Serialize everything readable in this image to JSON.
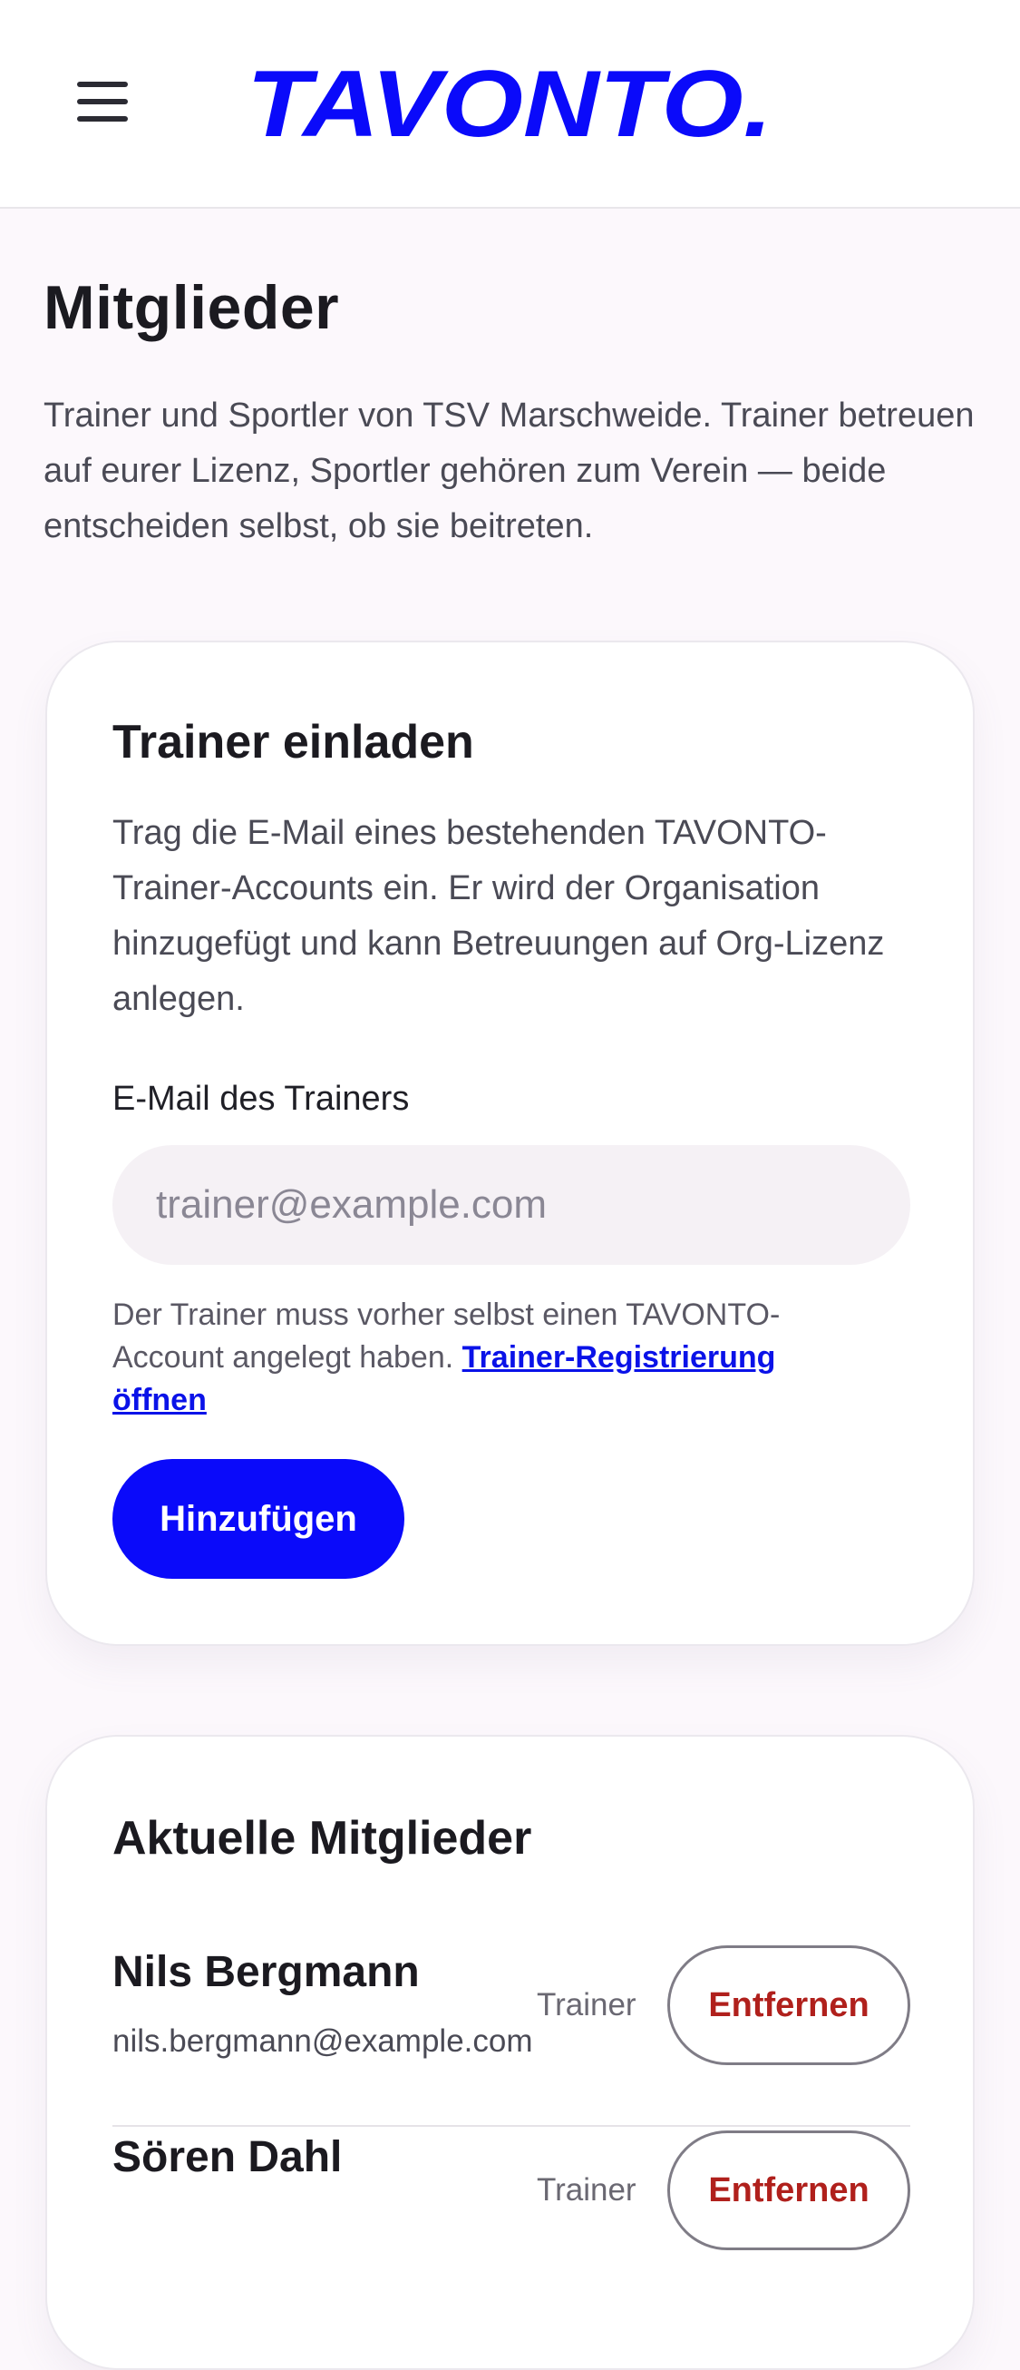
{
  "header": {
    "menu_icon": "hamburger-menu-icon",
    "logo_text": "TAVONTO.",
    "brand_color": "#0a0afa"
  },
  "page": {
    "title": "Mitglieder",
    "description": "Trainer und Sportler von TSV Marschweide. Trainer betreuen auf eurer Lizenz, Sportler gehören zum Verein — beide entscheiden selbst, ob sie beitreten."
  },
  "invite": {
    "title": "Trainer einladen",
    "text": "Trag die E-Mail eines bestehenden TAVONTO-Trainer-Accounts ein. Er wird der Organisation hinzugefügt und kann Betreuungen auf Org-Lizenz anlegen.",
    "email_label": "E-Mail des Trainers",
    "email_value": "",
    "email_placeholder": "trainer@example.com",
    "hint_text": "Der Trainer muss vorher selbst einen TAVONTO-Account angelegt haben.",
    "hint_link": "Trainer-Registrierung öffnen",
    "submit_label": "Hinzufügen"
  },
  "members": {
    "title": "Aktuelle Mitglieder",
    "items": [
      {
        "name": "Nils Bergmann",
        "email": "nils.bergmann@example.com",
        "role": "Trainer",
        "remove_label": "Entfernen"
      },
      {
        "name": "Sören Dahl",
        "email": "",
        "role": "Trainer",
        "remove_label": "Entfernen"
      }
    ]
  }
}
